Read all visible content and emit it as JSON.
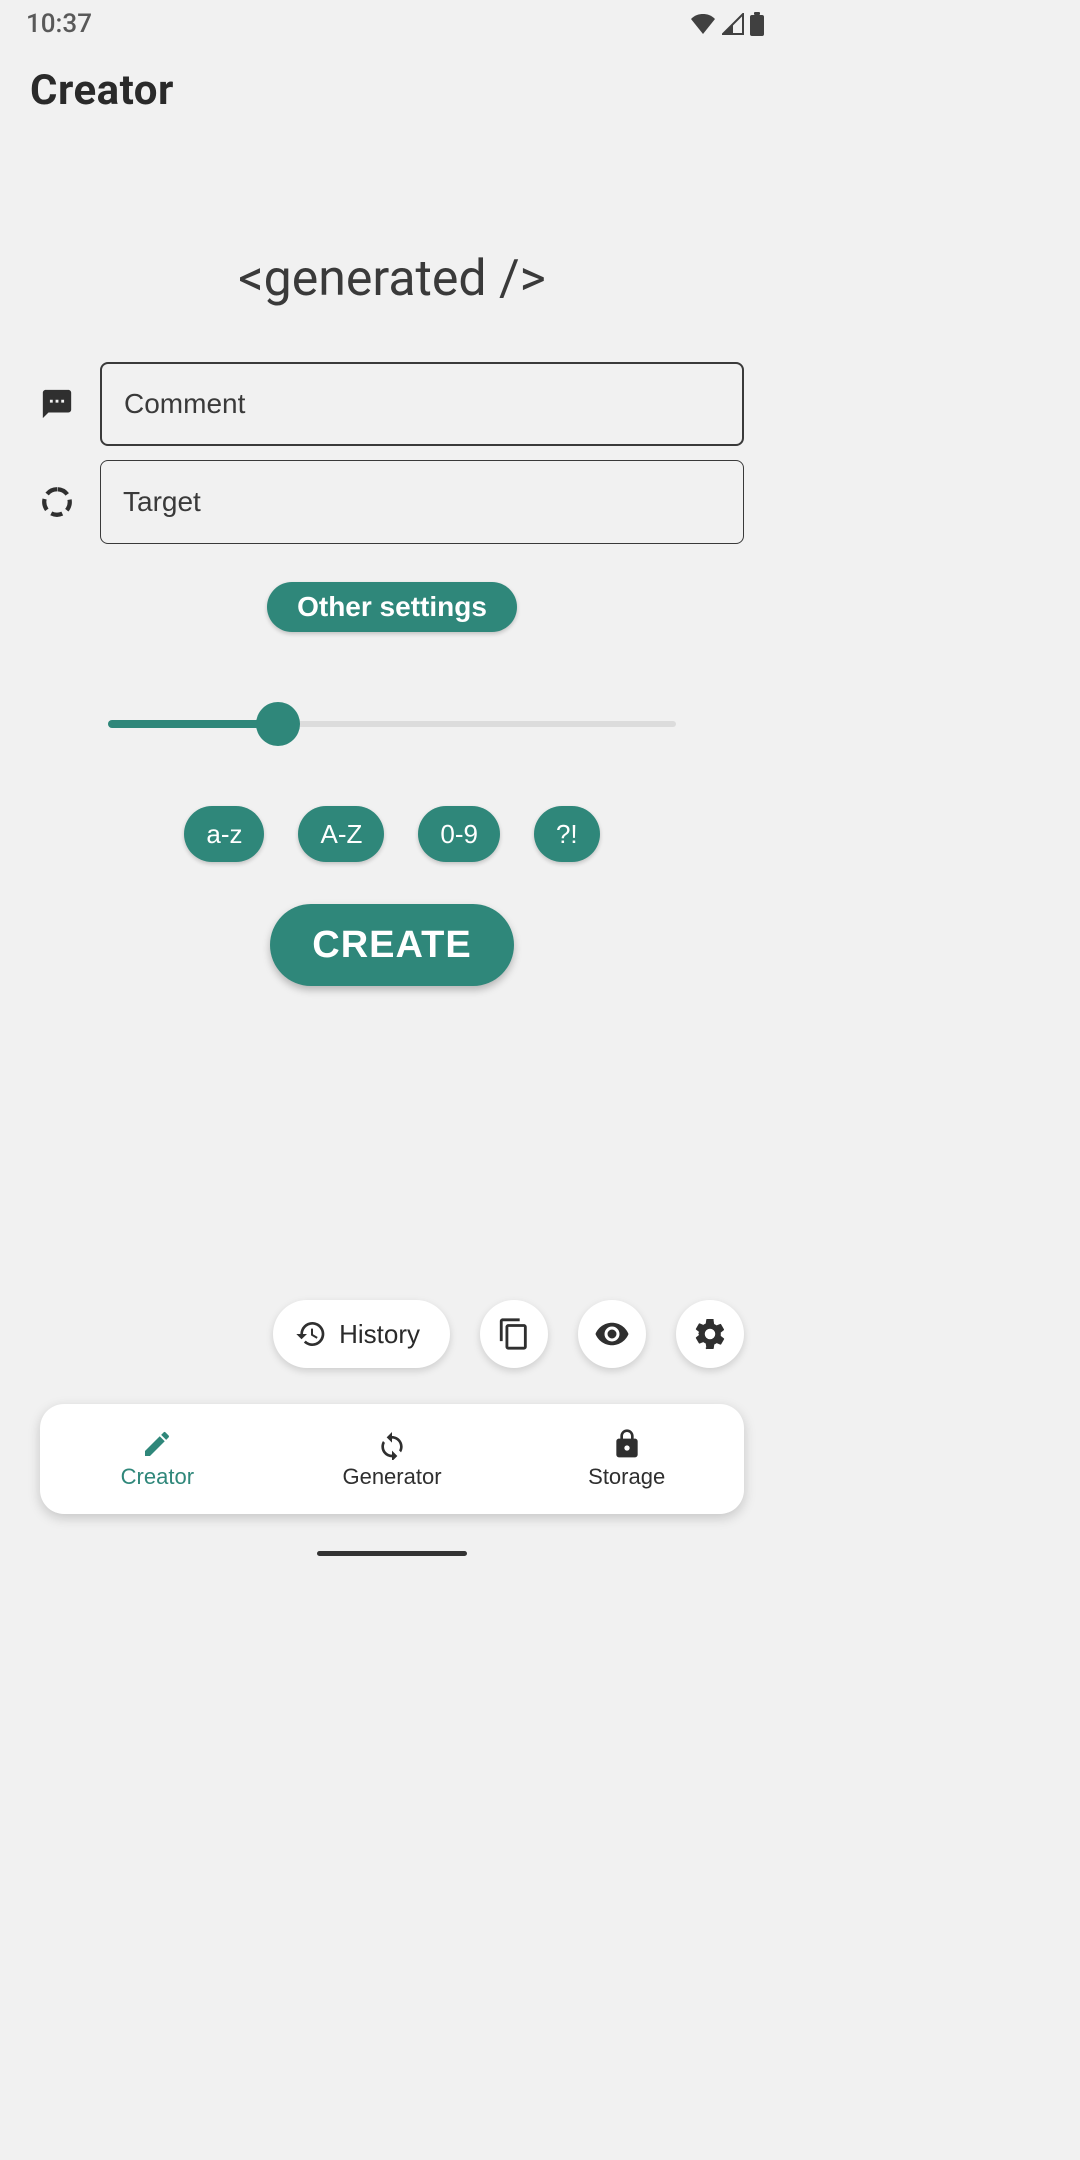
{
  "status": {
    "time": "10:37"
  },
  "header": {
    "title": "Creator"
  },
  "generated": {
    "text": "<generated />"
  },
  "fields": {
    "comment": {
      "placeholder": "Comment"
    },
    "target": {
      "placeholder": "Target"
    }
  },
  "other_settings": {
    "label": "Other settings"
  },
  "slider": {
    "percent": 30
  },
  "chips": {
    "lower": "a-z",
    "upper": "A-Z",
    "digits": "0-9",
    "symbols": "?!"
  },
  "create_button": {
    "label": "CREATE"
  },
  "actions": {
    "history_label": "History"
  },
  "nav": {
    "creator": "Creator",
    "generator": "Generator",
    "storage": "Storage"
  },
  "colors": {
    "accent": "#2f877a"
  }
}
